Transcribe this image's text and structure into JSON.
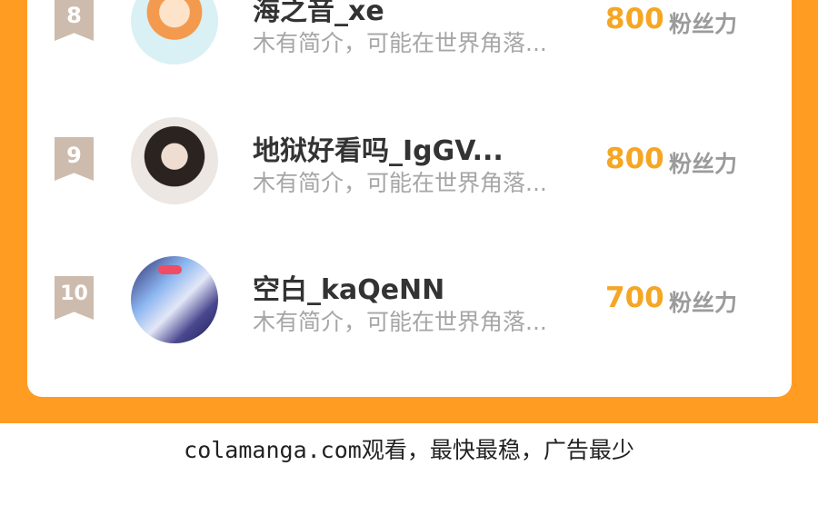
{
  "leaderboard": {
    "rows": [
      {
        "rank": "8",
        "avatar_icon": "avatar-cartoon-girl-icon",
        "username": "海之音_xe",
        "bio": "木有简介，可能在世界角落...",
        "fans_count": "800",
        "fans_label": "粉丝力"
      },
      {
        "rank": "9",
        "avatar_icon": "avatar-girl-photo-icon",
        "username": "地狱好看吗_IgGV...",
        "bio": "木有简介，可能在世界角落...",
        "fans_count": "800",
        "fans_label": "粉丝力"
      },
      {
        "rank": "10",
        "avatar_icon": "avatar-anime-icon",
        "username": "空白_kaQeNN",
        "bio": "木有简介，可能在世界角落...",
        "fans_count": "700",
        "fans_label": "粉丝力"
      }
    ]
  },
  "footer": {
    "watermark": "colamanga.com观看，最快最稳，广告最少"
  },
  "colors": {
    "background_orange": "#ff9c21",
    "fans_count": "#f5a623",
    "rank_badge": "#cdbcae"
  }
}
